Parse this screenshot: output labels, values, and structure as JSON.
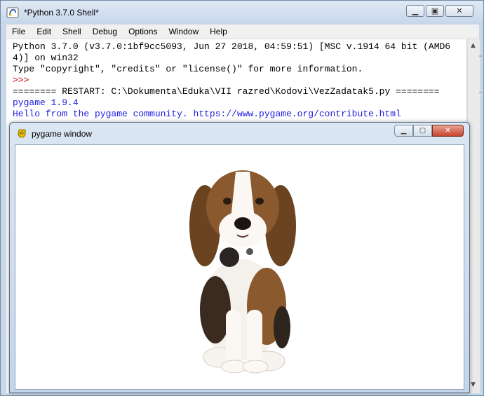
{
  "shell": {
    "title": "*Python 3.7.0 Shell*",
    "menu": [
      "File",
      "Edit",
      "Shell",
      "Debug",
      "Options",
      "Window",
      "Help"
    ],
    "lines": [
      {
        "text": "Python 3.7.0 (v3.7.0:1bf9cc5093, Jun 27 2018, 04:59:51) [MSC v.1914 64 bit (AMD6",
        "color": "black"
      },
      {
        "text": "4)] on win32",
        "color": "black"
      },
      {
        "text": "Type \"copyright\", \"credits\" or \"license()\" for more information.",
        "color": "black"
      },
      {
        "text": ">>>",
        "color": "red"
      },
      {
        "text": "======== RESTART: C:\\Dokumenta\\Eduka\\VII razred\\Kodovi\\VezZadatak5.py ========",
        "color": "black"
      },
      {
        "text": "pygame 1.9.4",
        "color": "blue"
      },
      {
        "text": "Hello from the pygame community. https://www.pygame.org/contribute.html",
        "color": "blue"
      }
    ]
  },
  "pygame": {
    "title": "pygame window",
    "image_subject": "beagle puppy sitting"
  },
  "colors": {
    "prompt": "#c00000",
    "stdout": "#1c1ce0",
    "close_button": "#c7452e"
  },
  "icons": [
    "python-shell-icon",
    "minimize-icon",
    "maximize-icon",
    "close-icon",
    "pygame-icon",
    "scroll-up-icon",
    "scroll-down-icon"
  ]
}
